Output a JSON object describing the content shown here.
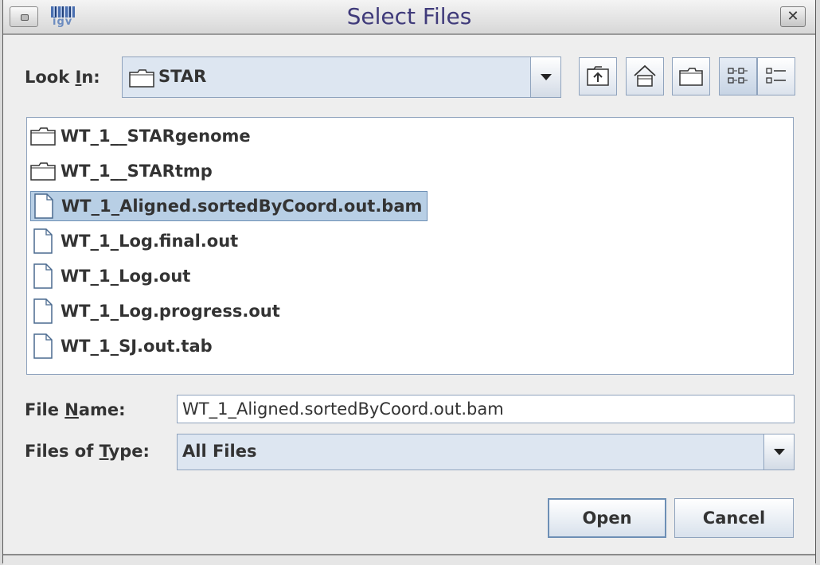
{
  "window": {
    "title": "Select Files",
    "app_icon_text": "igv",
    "menu_icon": "window-menu-icon",
    "close_icon": "close-icon",
    "close_glyph": "✕"
  },
  "look_in": {
    "label_pre": "Look ",
    "label_mnemonic": "I",
    "label_post": "n:",
    "value": "STAR",
    "value_icon": "folder-icon"
  },
  "toolbar": {
    "buttons": [
      {
        "name": "up-one-level-button",
        "icon": "folder-up-icon"
      },
      {
        "name": "home-button",
        "icon": "home-icon"
      },
      {
        "name": "new-folder-button",
        "icon": "new-folder-icon"
      },
      {
        "name": "list-view-button",
        "icon": "list-view-icon",
        "active": true
      },
      {
        "name": "details-view-button",
        "icon": "details-view-icon"
      }
    ]
  },
  "files": [
    {
      "name": "WT_1__STARgenome",
      "type": "folder"
    },
    {
      "name": "WT_1__STARtmp",
      "type": "folder"
    },
    {
      "name": "WT_1_Aligned.sortedByCoord.out.bam",
      "type": "file",
      "selected": true
    },
    {
      "name": "WT_1_Log.final.out",
      "type": "file"
    },
    {
      "name": "WT_1_Log.out",
      "type": "file"
    },
    {
      "name": "WT_1_Log.progress.out",
      "type": "file"
    },
    {
      "name": "WT_1_SJ.out.tab",
      "type": "file"
    }
  ],
  "file_name": {
    "label_pre": "File ",
    "label_mnemonic": "N",
    "label_post": "ame:",
    "value": "WT_1_Aligned.sortedByCoord.out.bam"
  },
  "files_of_type": {
    "label_pre": "Files of ",
    "label_mnemonic": "T",
    "label_post": "ype:",
    "value": "All Files"
  },
  "buttons": {
    "open": "Open",
    "cancel": "Cancel"
  },
  "colors": {
    "selection": "#b8cfe5",
    "title_text": "#3f3a7a",
    "border": "#8fa3bd"
  }
}
